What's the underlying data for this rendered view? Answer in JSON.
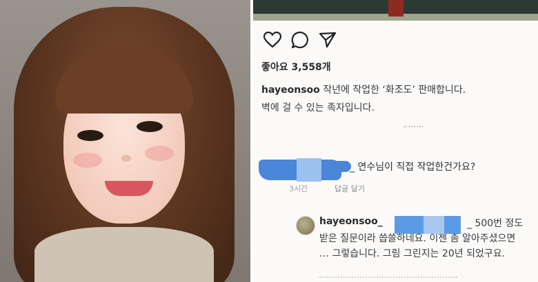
{
  "photo": {
    "description_icon": "portrait-photo"
  },
  "instagram": {
    "icons": [
      "heart-icon",
      "comment-icon",
      "send-icon"
    ],
    "likes_label": "좋아요 3,558개",
    "post": {
      "username": "hayeonsoo",
      "caption_part1": "작년에 작업한",
      "caption_quote": "‘화조도’",
      "caption_part2": "판매합니다.",
      "caption_line2": "벽에 걸 수 있는 족자입니다."
    },
    "comment1": {
      "text": "_ 연수님이 직접 작업한건가요?",
      "time": "3시간",
      "reply_label": "답글 달기"
    },
    "comment2": {
      "username": "hayeonsoo_",
      "text": "_ 500번 정도 받은 질문이라 씁쓸하네요. 이젠 좀 알아주셨으면 … 그렇습니다. 그림 그린지는 20년 되었구요."
    },
    "colors": {
      "redaction_blue": "#4a86d9",
      "redaction_light": "#9cc0ef",
      "text_dark": "#2b2b2b"
    }
  }
}
